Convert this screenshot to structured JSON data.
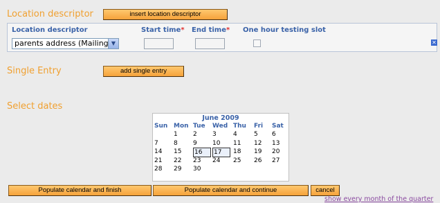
{
  "location_section": {
    "title": "Location descriptor",
    "insert_button": "insert location descriptor"
  },
  "panel": {
    "col_location": "Location descriptor",
    "col_start": "Start time",
    "col_end": "End time",
    "required_mark": "*",
    "col_slot": "One hour testing slot",
    "select_value": "parents address (Mailing",
    "start_value": "",
    "end_value": "",
    "slot_checked": false,
    "remove_icon": "close-icon"
  },
  "single_entry": {
    "title": "Single Entry",
    "button": "add single entry"
  },
  "select_dates": {
    "title": "Select dates"
  },
  "calendar": {
    "month_title": "June 2009",
    "weekdays": [
      "Sun",
      "Mon",
      "Tue",
      "Wed",
      "Thu",
      "Fri",
      "Sat"
    ],
    "weeks": [
      [
        "",
        "1",
        "2",
        "3",
        "4",
        "5",
        "6"
      ],
      [
        "7",
        "8",
        "9",
        "10",
        "11",
        "12",
        "13"
      ],
      [
        "14",
        "15",
        "16",
        "17",
        "18",
        "19",
        "20"
      ],
      [
        "21",
        "22",
        "23",
        "24",
        "25",
        "26",
        "27"
      ],
      [
        "28",
        "29",
        "30",
        "",
        "",
        "",
        ""
      ]
    ],
    "selected_days": [
      "16",
      "17"
    ]
  },
  "actions": {
    "finish": "Populate calendar and finish",
    "continue": "Populate calendar and continue",
    "cancel": "cancel"
  },
  "footer": {
    "quarter_link": "show every month of the quarter"
  },
  "colors": {
    "accent_orange": "#f0a030",
    "header_blue": "#3a62a8",
    "link_purple": "#8a4aa0"
  }
}
